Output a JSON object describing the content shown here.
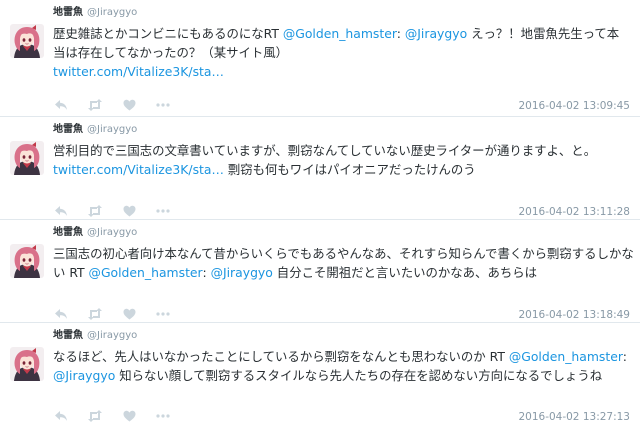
{
  "colors": {
    "text": "#292f33",
    "muted": "#8899a6",
    "link": "#1b95e0",
    "divider": "#e1e8ed"
  },
  "tweets": [
    {
      "display_name": "地雷魚",
      "screen_name": "@Jiraygyo",
      "lines": [
        [
          {
            "type": "text",
            "text": "歴史雑誌とかコンビニにもあるのになRT "
          },
          {
            "type": "mention",
            "text": "@Golden_hamster"
          },
          {
            "type": "text",
            "text": ": "
          },
          {
            "type": "mention",
            "text": "@Jiraygyo"
          },
          {
            "type": "text",
            "text": " えっ？！地雷魚先生って本"
          }
        ],
        [
          {
            "type": "text",
            "text": "当は存在してなかったの？（某サイト風）"
          }
        ],
        [
          {
            "type": "link",
            "text": "twitter.com/Vitalize3K/sta…"
          }
        ]
      ],
      "timestamp": "2016-04-02 13:09:45",
      "action_icons": [
        "reply-icon",
        "retweet-icon",
        "favorite-icon",
        "more-icon"
      ]
    },
    {
      "display_name": "地雷魚",
      "screen_name": "@Jiraygyo",
      "lines": [
        [
          {
            "type": "text",
            "text": "営利目的で三国志の文章書いていますが、剽窃なんてしていない歴史ライターが通りますよ、と。"
          }
        ],
        [
          {
            "type": "link",
            "text": "twitter.com/Vitalize3K/sta…"
          },
          {
            "type": "text",
            "text": " 剽窃も何もワイはパイオニアだったけんのう"
          }
        ]
      ],
      "timestamp": "2016-04-02 13:11:28",
      "action_icons": [
        "reply-icon",
        "retweet-icon",
        "favorite-icon",
        "more-icon"
      ]
    },
    {
      "display_name": "地雷魚",
      "screen_name": "@Jiraygyo",
      "lines": [
        [
          {
            "type": "text",
            "text": "三国志の初心者向け本なんて昔からいくらでもあるやんなあ、それすら知らんで書くから剽窃するしかな"
          }
        ],
        [
          {
            "type": "text",
            "text": "い RT "
          },
          {
            "type": "mention",
            "text": "@Golden_hamster"
          },
          {
            "type": "text",
            "text": ": "
          },
          {
            "type": "mention",
            "text": "@Jiraygyo"
          },
          {
            "type": "text",
            "text": " 自分こそ開祖だと言いたいのかなあ、あちらは"
          }
        ]
      ],
      "timestamp": "2016-04-02 13:18:49",
      "action_icons": [
        "reply-icon",
        "retweet-icon",
        "favorite-icon",
        "more-icon"
      ]
    },
    {
      "display_name": "地雷魚",
      "screen_name": "@Jiraygyo",
      "lines": [
        [
          {
            "type": "text",
            "text": "なるほど、先人はいなかったことにしているから剽窃をなんとも思わないのか RT "
          },
          {
            "type": "mention",
            "text": "@Golden_hamster"
          },
          {
            "type": "text",
            "text": ":"
          }
        ],
        [
          {
            "type": "mention",
            "text": "@Jiraygyo"
          },
          {
            "type": "text",
            "text": " 知らない顔して剽窃するスタイルなら先人たちの存在を認めない方向になるでしょうね"
          }
        ]
      ],
      "timestamp": "2016-04-02 13:27:13",
      "action_icons": [
        "reply-icon",
        "retweet-icon",
        "favorite-icon",
        "more-icon"
      ]
    }
  ]
}
